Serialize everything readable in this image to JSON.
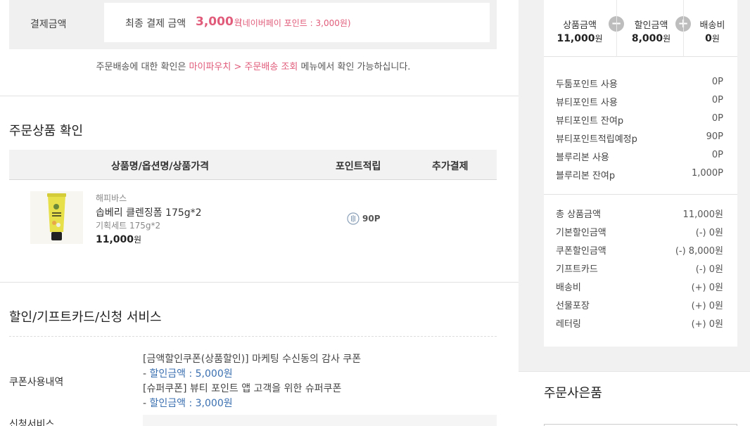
{
  "payment": {
    "label": "결제금액",
    "final_label": "최종 결제 금액",
    "final_amount": "3,000",
    "won": "원",
    "npay_note": "(네이버페이 포인트 : 3,000원)"
  },
  "notice": {
    "before": "주문배송에 대한 확인은 ",
    "link": "마이파우치 > 주문배송 조회",
    "after": " 메뉴에서 확인 가능하십니다."
  },
  "order_items": {
    "title": "주문상품 확인",
    "headers": [
      "상품명/옵션명/상품가격",
      "포인트적립",
      "추가결제"
    ],
    "product": {
      "brand": "해피바스",
      "name": "솝베리 클렌징폼 175g*2",
      "option": "기획세트 175g*2",
      "price": "11,000",
      "won": "원",
      "point": "90P",
      "image_icon": "cleansing-foam-tube-image"
    }
  },
  "discount": {
    "title": "할인/기프트카드/신청 서비스",
    "coupon_label": "쿠폰사용내역",
    "apply_label": "신청서비스",
    "coupons": [
      {
        "name": "[금액할인쿠폰(상품할인)] 마케팅 수신동의 감사 쿠폰",
        "amount_prefix": "- ",
        "amount_text": "할인금액 : 5,000원"
      },
      {
        "name": "[슈퍼쿠폰] 뷰티 포인트 앱 고객을 위한 슈퍼쿠폰",
        "amount_prefix": "- ",
        "amount_text": "할인금액 : 3,000원"
      }
    ]
  },
  "summary": {
    "top": [
      {
        "label": "상품금액",
        "value": "11,000",
        "won": "원"
      },
      {
        "label": "할인금액",
        "value": "8,000",
        "won": "원"
      },
      {
        "label": "배송비",
        "value": "0",
        "won": "원"
      }
    ],
    "operators": [
      "−",
      "+"
    ],
    "points": [
      {
        "label": "두툼포인트 사용",
        "value": "0P"
      },
      {
        "label": "뷰티포인트 사용",
        "value": "0P"
      },
      {
        "label": "뷰티포인트 잔여p",
        "value": "0P"
      },
      {
        "label": "뷰티포인트적립예정p",
        "value": "90P"
      },
      {
        "label": "블루리본 사용",
        "value": "0P"
      },
      {
        "label": "블루리본 잔여p",
        "value": "1,000P"
      }
    ],
    "amounts": [
      {
        "label": "총 상품금액",
        "value": "11,000원"
      },
      {
        "label": "기본할인금액",
        "value": "(-) 0원"
      },
      {
        "label": "쿠폰할인금액",
        "value": "(-) 8,000원"
      },
      {
        "label": "기프트카드",
        "value": "(-) 0원"
      },
      {
        "label": "배송비",
        "value": "(+) 0원"
      },
      {
        "label": "선물포장",
        "value": "(+) 0원"
      },
      {
        "label": "레터링",
        "value": "(+) 0원"
      }
    ]
  },
  "gift": {
    "title": "주문사은품"
  },
  "colors": {
    "accent_pink": "#e05c7a",
    "link_blue": "#3a6fb0",
    "panel_gray": "#f1f1f1"
  }
}
